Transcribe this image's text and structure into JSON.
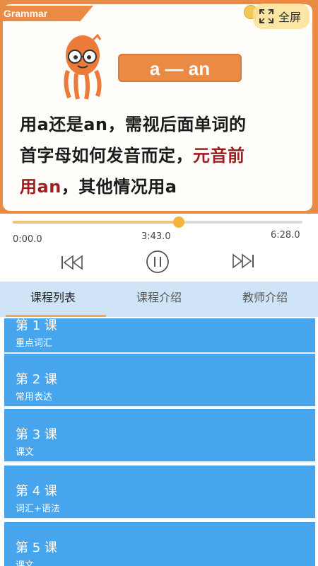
{
  "video": {
    "tag": "Grammar",
    "fullscreen_label": "全屏",
    "pill_text": "a — an",
    "slide_lines": [
      {
        "plain": "用a还是an，需视后面单词的"
      },
      {
        "plain": "首字母如何发音而定，",
        "highlight": "元音前"
      },
      {
        "highlight": "用an",
        "plain": "，其他情况用a"
      }
    ],
    "colors": {
      "frame": "#e98a45",
      "highlight": "#a01d22"
    }
  },
  "player": {
    "time_start": "0:00.0",
    "time_current": "3:43.0",
    "time_end": "6:28.0",
    "progress": 0.573,
    "icons": {
      "prev": "skip-back-icon",
      "play": "pause-icon",
      "next": "skip-forward-icon"
    }
  },
  "tabs": [
    {
      "label": "课程列表",
      "active": true
    },
    {
      "label": "课程介绍",
      "active": false
    },
    {
      "label": "教师介绍",
      "active": false
    }
  ],
  "lessons": [
    {
      "title": "第 1 课",
      "subtitle": "重点词汇"
    },
    {
      "title": "第 2 课",
      "subtitle": "常用表达"
    },
    {
      "title": "第 3 课",
      "subtitle": "课文"
    },
    {
      "title": "第 4 课",
      "subtitle": "词汇+语法"
    },
    {
      "title": "第 5 课",
      "subtitle": "课文"
    }
  ]
}
